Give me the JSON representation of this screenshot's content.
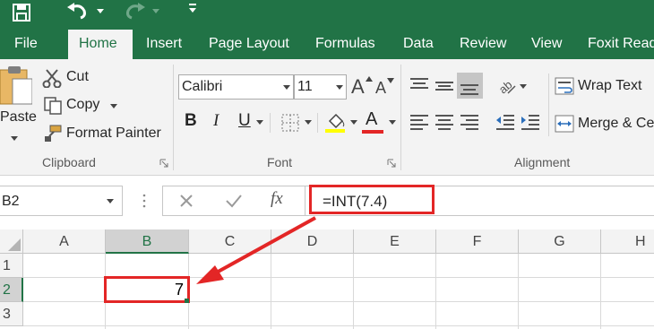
{
  "colors": {
    "excel_green": "#217346",
    "ribbon_bg": "#f3f3f3",
    "annotation_red": "#e32626",
    "fill_yellow": "#ffff00",
    "font_red": "#e32626"
  },
  "tabs": [
    "File",
    "Home",
    "Insert",
    "Page Layout",
    "Formulas",
    "Data",
    "Review",
    "View",
    "Foxit Read"
  ],
  "active_tab": "Home",
  "clipboard": {
    "paste_label": "Paste",
    "cut_label": "Cut",
    "copy_label": "Copy",
    "format_painter_label": "Format Painter",
    "group_label": "Clipboard"
  },
  "font": {
    "font_name": "Calibri",
    "font_size": "11",
    "bold_label": "B",
    "italic_label": "I",
    "underline_label": "U",
    "grow_label": "A",
    "shrink_label": "A",
    "font_color_label": "A",
    "group_label": "Font"
  },
  "alignment": {
    "wrap_text_label": "Wrap Text",
    "merge_label": "Merge & Ce",
    "group_label": "Alignment"
  },
  "formula_bar": {
    "name_box": "B2",
    "fx_label": "fx",
    "formula": "=INT(7.4)"
  },
  "grid": {
    "columns": [
      "A",
      "B",
      "C",
      "D",
      "E",
      "F",
      "G",
      "H"
    ],
    "rows": [
      "1",
      "2",
      "3"
    ],
    "selected_cell": "B2",
    "cell_b2_value": "7"
  }
}
